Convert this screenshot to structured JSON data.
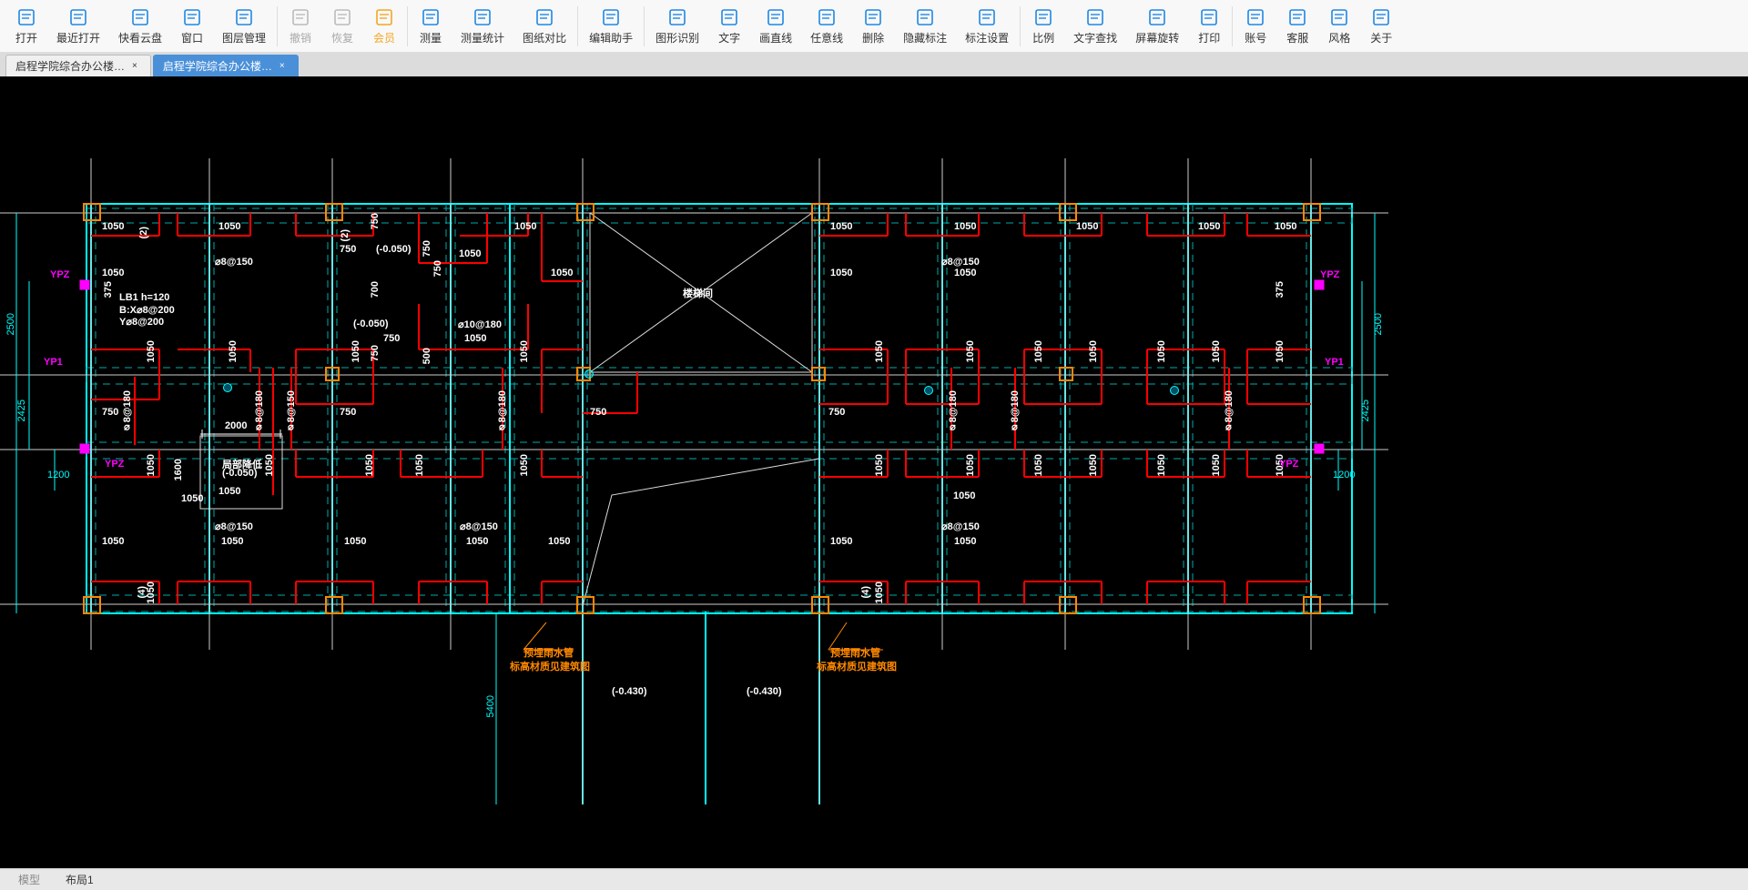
{
  "toolbar": [
    {
      "id": "open",
      "label": "打开"
    },
    {
      "id": "recent",
      "label": "最近打开"
    },
    {
      "id": "cloud",
      "label": "快看云盘"
    },
    {
      "id": "window",
      "label": "窗口"
    },
    {
      "id": "layers",
      "label": "图层管理"
    },
    {
      "id": "undo",
      "label": "撤销",
      "disabled": true
    },
    {
      "id": "redo",
      "label": "恢复",
      "disabled": true
    },
    {
      "id": "vip",
      "label": "会员",
      "vip": true
    },
    {
      "id": "measure",
      "label": "测量"
    },
    {
      "id": "measurestat",
      "label": "测量统计"
    },
    {
      "id": "compare",
      "label": "图纸对比"
    },
    {
      "id": "edithelper",
      "label": "编辑助手",
      "blue": true
    },
    {
      "id": "shaperec",
      "label": "图形识别"
    },
    {
      "id": "text",
      "label": "文字"
    },
    {
      "id": "line",
      "label": "画直线"
    },
    {
      "id": "freeline",
      "label": "任意线"
    },
    {
      "id": "delete",
      "label": "删除"
    },
    {
      "id": "hideannot",
      "label": "隐藏标注"
    },
    {
      "id": "annotset",
      "label": "标注设置"
    },
    {
      "id": "ratio",
      "label": "比例"
    },
    {
      "id": "findtext",
      "label": "文字查找"
    },
    {
      "id": "rotate",
      "label": "屏幕旋转"
    },
    {
      "id": "print",
      "label": "打印"
    },
    {
      "id": "account",
      "label": "账号"
    },
    {
      "id": "cs",
      "label": "客服"
    },
    {
      "id": "style",
      "label": "风格"
    },
    {
      "id": "about",
      "label": "关于"
    }
  ],
  "tabs": [
    {
      "label": "启程学院综合办公楼…",
      "active": false
    },
    {
      "label": "启程学院综合办公楼…",
      "active": true
    }
  ],
  "bottomTabs": {
    "model": "模型",
    "layout": "布局1"
  },
  "drawing": {
    "stairLabel": "楼梯间",
    "lb1": {
      "l1": "LB1 h=120",
      "l2": "B:X⌀8@200",
      "l3": "Y⌀8@200"
    },
    "localDrop": {
      "l1": "局部降低",
      "l2": "(-0.050)"
    },
    "pipeNote": {
      "l1": "预埋雨水管",
      "l2": "标高材质见建筑图"
    },
    "drop050": "(-0.050)",
    "drop430": "(-0.430)",
    "grid2": "(2)",
    "grid4": "(4)",
    "phi8_150": "⌀8@150",
    "phi8_180": "⌀8@180",
    "phi10_180": "⌀10@180",
    "d1050": "1050",
    "d750": "750",
    "d700": "700",
    "d500": "500",
    "d375": "375",
    "d2500": "2500",
    "d2425": "2425",
    "d1200": "1200",
    "d2000": "2000",
    "d1600": "1600",
    "d5400": "5400",
    "YPZ": "YPZ",
    "YP1": "YP1"
  }
}
